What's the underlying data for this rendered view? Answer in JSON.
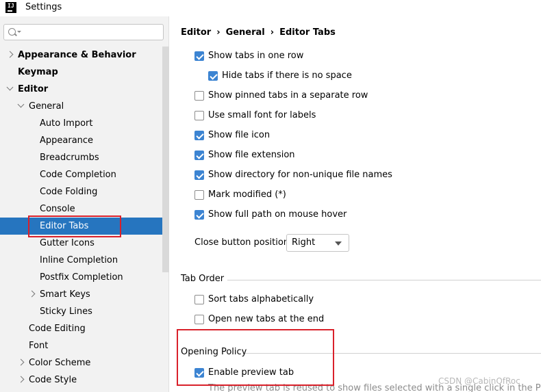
{
  "window": {
    "title": "Settings",
    "app_icon_text": "IJ"
  },
  "search": {
    "value": "",
    "placeholder": ""
  },
  "tree": [
    {
      "label": "Appearance & Behavior",
      "level": 0,
      "bold": true,
      "chevron": "right"
    },
    {
      "label": "Keymap",
      "level": 0,
      "bold": true,
      "chevron": "none"
    },
    {
      "label": "Editor",
      "level": 0,
      "bold": true,
      "chevron": "down"
    },
    {
      "label": "General",
      "level": 1,
      "bold": false,
      "chevron": "down"
    },
    {
      "label": "Auto Import",
      "level": 2,
      "bold": false,
      "chevron": "none"
    },
    {
      "label": "Appearance",
      "level": 2,
      "bold": false,
      "chevron": "none"
    },
    {
      "label": "Breadcrumbs",
      "level": 2,
      "bold": false,
      "chevron": "none"
    },
    {
      "label": "Code Completion",
      "level": 2,
      "bold": false,
      "chevron": "none"
    },
    {
      "label": "Code Folding",
      "level": 2,
      "bold": false,
      "chevron": "none"
    },
    {
      "label": "Console",
      "level": 2,
      "bold": false,
      "chevron": "none"
    },
    {
      "label": "Editor Tabs",
      "level": 2,
      "bold": false,
      "chevron": "none",
      "selected": true
    },
    {
      "label": "Gutter Icons",
      "level": 2,
      "bold": false,
      "chevron": "none"
    },
    {
      "label": "Inline Completion",
      "level": 2,
      "bold": false,
      "chevron": "none"
    },
    {
      "label": "Postfix Completion",
      "level": 2,
      "bold": false,
      "chevron": "none"
    },
    {
      "label": "Smart Keys",
      "level": 2,
      "bold": false,
      "chevron": "right"
    },
    {
      "label": "Sticky Lines",
      "level": 2,
      "bold": false,
      "chevron": "none"
    },
    {
      "label": "Code Editing",
      "level": 1,
      "bold": false,
      "chevron": "none"
    },
    {
      "label": "Font",
      "level": 1,
      "bold": false,
      "chevron": "none"
    },
    {
      "label": "Color Scheme",
      "level": 1,
      "bold": false,
      "chevron": "right"
    },
    {
      "label": "Code Style",
      "level": 1,
      "bold": false,
      "chevron": "right"
    }
  ],
  "breadcrumb": {
    "part1": "Editor",
    "part2": "General",
    "part3": "Editor Tabs",
    "separator": "›"
  },
  "options": [
    {
      "label": "Show tabs in one row",
      "checked": true,
      "indent": 0
    },
    {
      "label": "Hide tabs if there is no space",
      "checked": true,
      "indent": 1
    },
    {
      "label": "Show pinned tabs in a separate row",
      "checked": false,
      "indent": 0
    },
    {
      "label": "Use small font for labels",
      "checked": false,
      "indent": 0
    },
    {
      "label": "Show file icon",
      "checked": true,
      "indent": 0
    },
    {
      "label": "Show file extension",
      "checked": true,
      "indent": 0
    },
    {
      "label": "Show directory for non-unique file names",
      "checked": true,
      "indent": 0
    },
    {
      "label": "Mark modified (*)",
      "checked": false,
      "indent": 0
    },
    {
      "label": "Show full path on mouse hover",
      "checked": true,
      "indent": 0
    }
  ],
  "close_button": {
    "label": "Close button position:",
    "value": "Right"
  },
  "tab_order": {
    "title": "Tab Order",
    "options": [
      {
        "label": "Sort tabs alphabetically",
        "checked": false
      },
      {
        "label": "Open new tabs at the end",
        "checked": false
      }
    ]
  },
  "opening_policy": {
    "title": "Opening Policy",
    "options": [
      {
        "label": "Enable preview tab",
        "checked": true
      }
    ],
    "note": "The preview tab is reused to show files selected with a single click in the Project"
  },
  "watermark": "CSDN @CabinOfRoc",
  "colors": {
    "selection": "#2675bf",
    "checkbox": "#3c84d2",
    "highlight_box": "#d9202a"
  }
}
